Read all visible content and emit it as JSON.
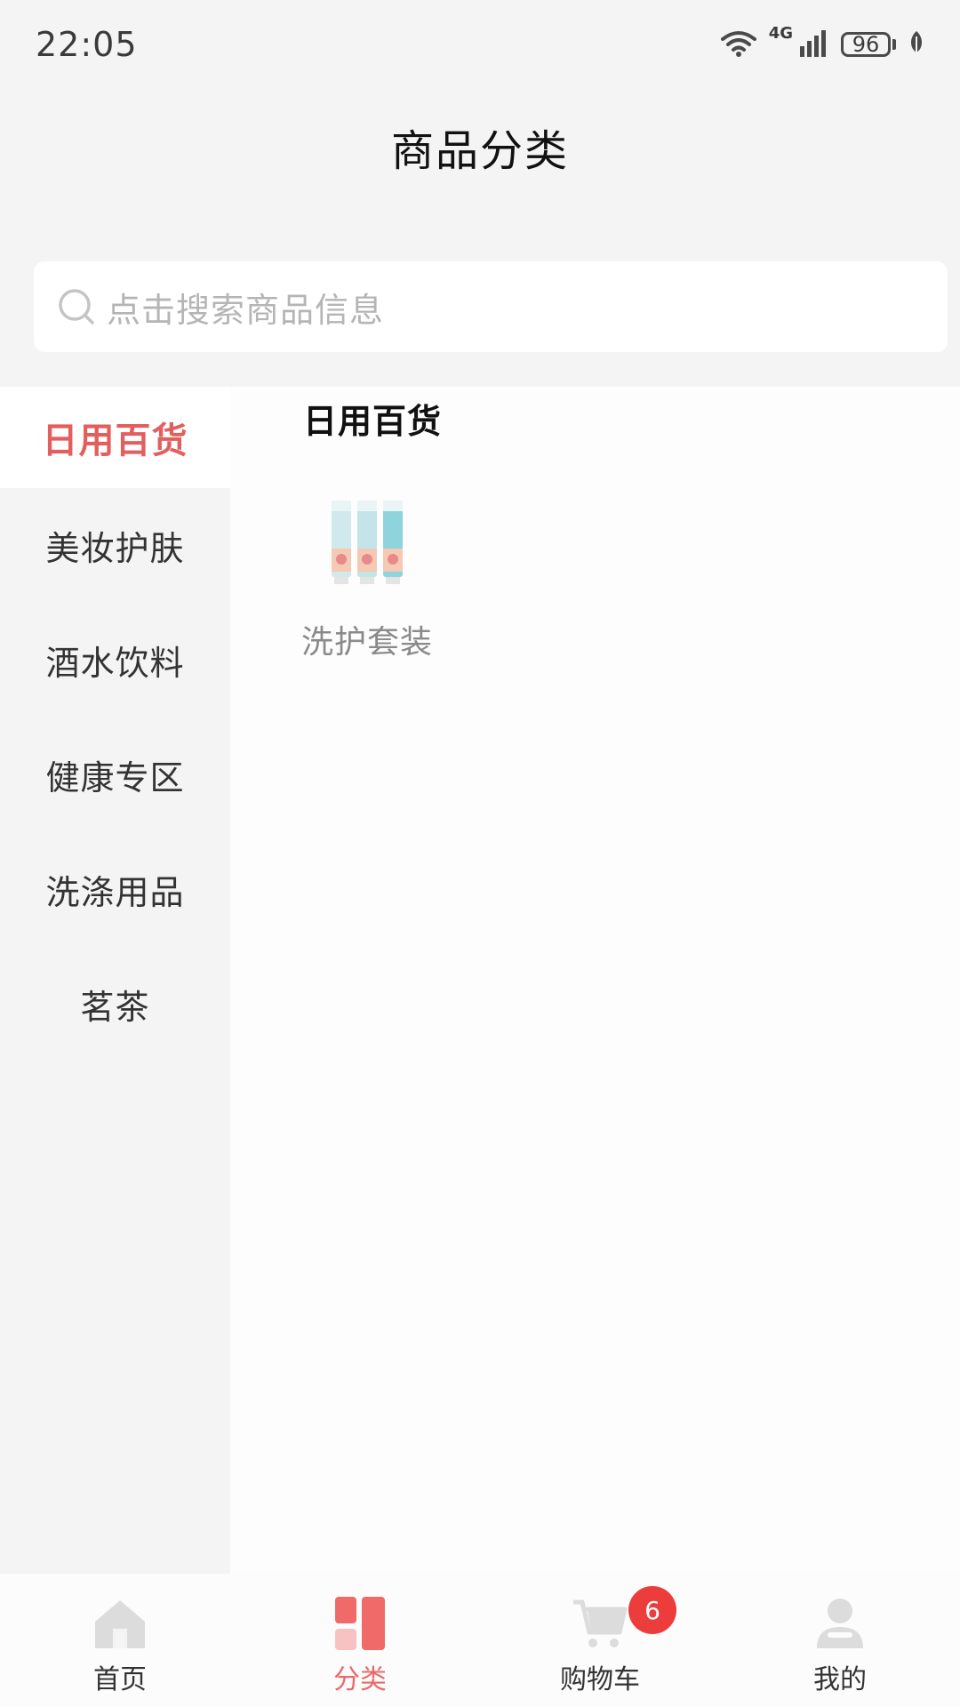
{
  "status_bar": {
    "time": "22:05",
    "network": "4G",
    "battery": "96"
  },
  "header": {
    "title": "商品分类"
  },
  "search": {
    "placeholder": "点击搜索商品信息"
  },
  "sidebar": {
    "items": [
      {
        "label": "日用百货"
      },
      {
        "label": "美妆护肤"
      },
      {
        "label": "酒水饮料"
      },
      {
        "label": "健康专区"
      },
      {
        "label": "洗涤用品"
      },
      {
        "label": "茗茶"
      }
    ]
  },
  "content": {
    "section_title": "日用百货",
    "products": [
      {
        "name": "洗护套装"
      }
    ]
  },
  "tab_bar": {
    "tabs": [
      {
        "label": "首页",
        "icon": "home-icon"
      },
      {
        "label": "分类",
        "icon": "category-icon"
      },
      {
        "label": "购物车",
        "icon": "cart-icon",
        "badge": "6"
      },
      {
        "label": "我的",
        "icon": "profile-icon"
      }
    ]
  },
  "colors": {
    "accent": "#e35e5e",
    "badge": "#ec3c3c"
  }
}
